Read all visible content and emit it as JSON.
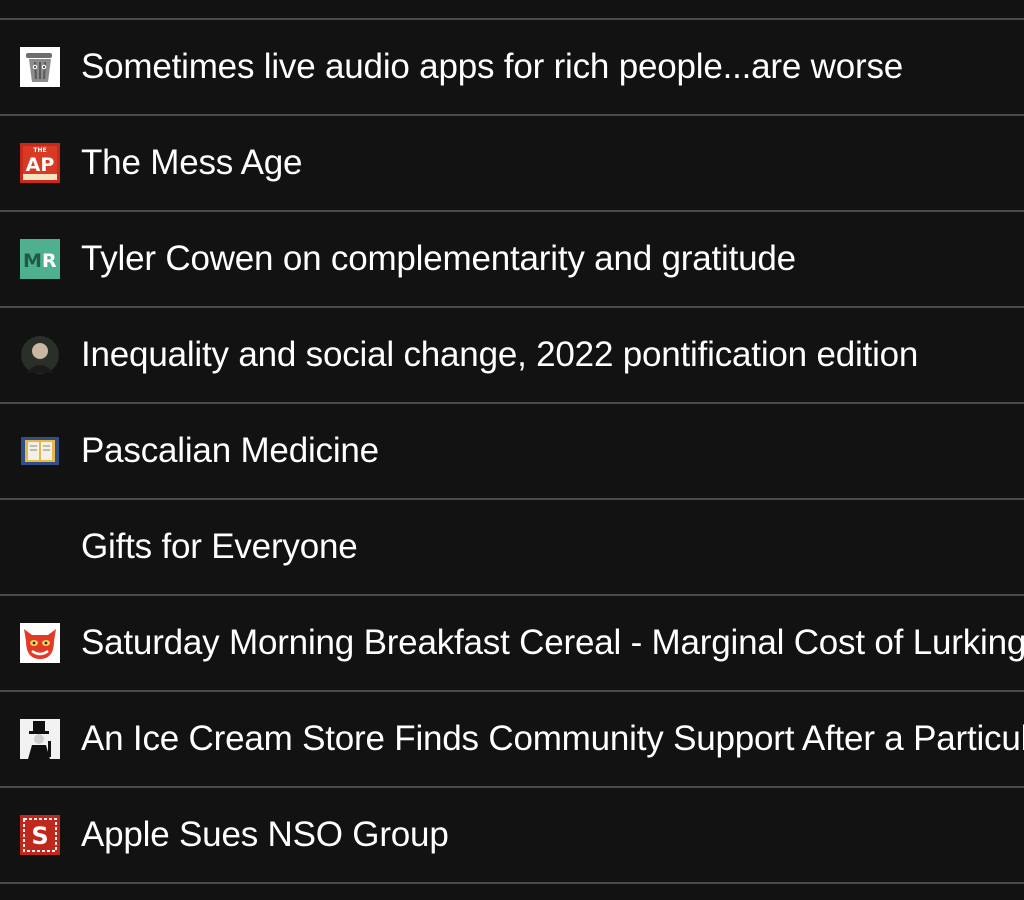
{
  "feed": {
    "items": [
      {
        "title": "Sometimes live audio apps for rich people...are worse",
        "icon": "trash-can-mascot-icon"
      },
      {
        "title": "The Mess Age",
        "icon": "ap-logo-icon"
      },
      {
        "title": "Tyler Cowen on complementarity and gratitude",
        "icon": "mr-logo-icon"
      },
      {
        "title": "Inequality and social change, 2022 pontification edition",
        "icon": "author-avatar-icon"
      },
      {
        "title": "Pascalian Medicine",
        "icon": "book-icon"
      },
      {
        "title": "Gifts for Everyone",
        "icon": ""
      },
      {
        "title": "Saturday Morning Breakfast Cereal - Marginal Cost of Lurking",
        "icon": "red-devil-face-icon"
      },
      {
        "title": "An Ice Cream Store Finds Community Support After a Particular",
        "icon": "top-hat-figure-icon"
      },
      {
        "title": "Apple Sues NSO Group",
        "icon": "s-logo-icon"
      }
    ]
  },
  "colors": {
    "background": "#121212",
    "divider": "#4a4a4a",
    "text": "#ffffff"
  }
}
